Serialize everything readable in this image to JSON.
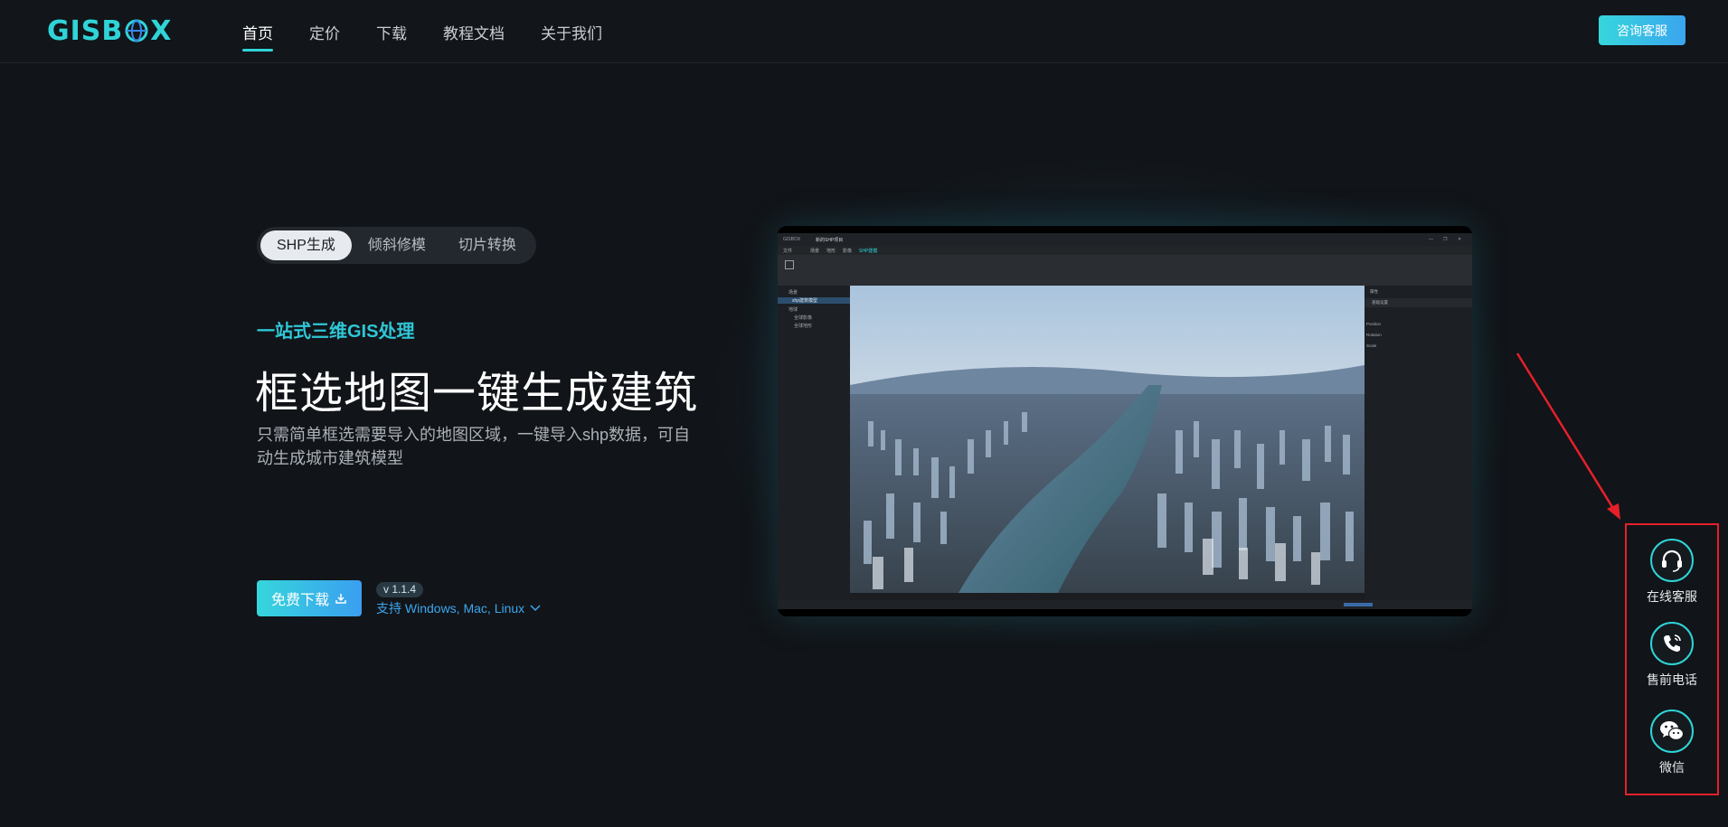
{
  "brand": {
    "logo_left": "GIS",
    "logo_right": "X",
    "accent": "#2fd4d8"
  },
  "nav": {
    "items": [
      {
        "label": "首页",
        "active": true
      },
      {
        "label": "定价",
        "active": false
      },
      {
        "label": "下载",
        "active": false
      },
      {
        "label": "教程文档",
        "active": false
      },
      {
        "label": "关于我们",
        "active": false
      }
    ],
    "consult_label": "咨询客服"
  },
  "hero": {
    "tabs": [
      {
        "label": "SHP生成",
        "active": true
      },
      {
        "label": "倾斜修模",
        "active": false
      },
      {
        "label": "切片转换",
        "active": false
      }
    ],
    "subtitle": "一站式三维GIS处理",
    "title": "框选地图一键生成建筑",
    "description": "只需简单框选需要导入的地图区域，一键导入shp数据，可自动生成城市建筑模型",
    "download_label": "免费下载",
    "version": "v 1.1.4",
    "support_text": "支持 Windows, Mac, Linux"
  },
  "preview": {
    "app_title": "GISBOX",
    "tab_name": "新的SHP项目",
    "menu": [
      "文件",
      "场景",
      "地形",
      "影像",
      "SHP建模"
    ],
    "tree": [
      "场景",
      "shp建筑模型",
      "地球",
      "全球影像",
      "全球地形"
    ],
    "panel_tab": "属性",
    "panel_section": "基础设置",
    "panel_rows": [
      "Position",
      "Rotation",
      "Scale"
    ]
  },
  "float_panel": {
    "items": [
      {
        "label": "在线客服",
        "icon": "headset-icon"
      },
      {
        "label": "售前电话",
        "icon": "phone-icon"
      },
      {
        "label": "微信",
        "icon": "wechat-icon"
      }
    ]
  }
}
